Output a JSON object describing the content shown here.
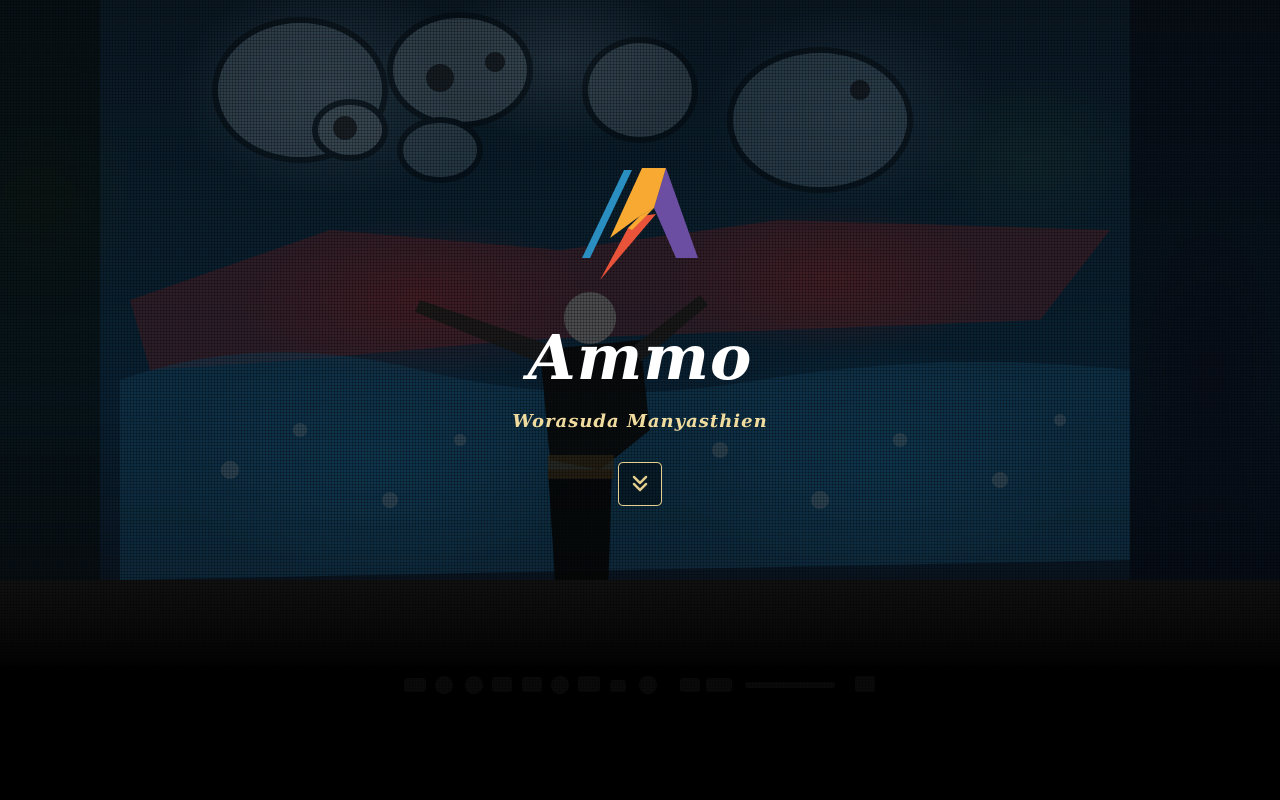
{
  "hero": {
    "title": "Ammo",
    "subtitle": "Worasuda Manyasthien",
    "background_image": "graffiti-wall-dancer",
    "scroll_button_icon": "double-chevron-down-icon"
  },
  "logo": {
    "icon": "ammo-lightning-a-logo",
    "colors": [
      "#f7a932",
      "#6b4ea1",
      "#2a8fc0",
      "#e8533a"
    ]
  },
  "colors": {
    "title": "#ffffff",
    "subtitle": "#f1dca0",
    "button_border": "#e6cf8e",
    "background": "#000000"
  }
}
